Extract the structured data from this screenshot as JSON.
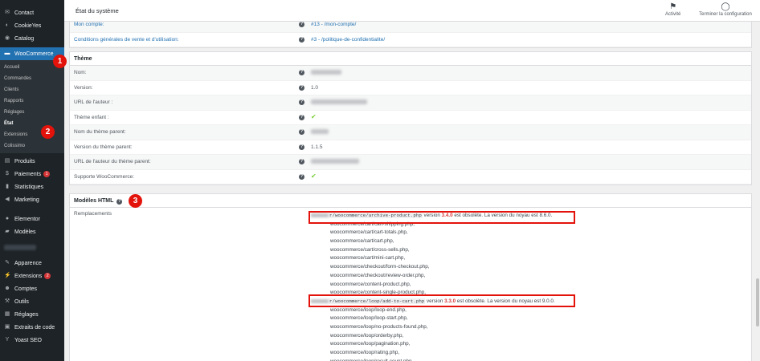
{
  "sidebar": {
    "items_top": [
      {
        "label": "Contact",
        "icon": "mail-icon"
      },
      {
        "label": "CookieYes",
        "icon": "cookie-icon"
      },
      {
        "label": "Catalog",
        "icon": "catalog-icon"
      }
    ],
    "woocommerce": {
      "label": "WooCommerce"
    },
    "woo_submenu": [
      "Accueil",
      "Commandes",
      "Clients",
      "Rapports",
      "Réglages",
      "État",
      "Extensions",
      "Colissimo"
    ],
    "items_mid": [
      {
        "label": "Produits",
        "icon": "products-icon"
      },
      {
        "label": "Paiements",
        "icon": "payments-icon",
        "badge": "1"
      },
      {
        "label": "Statistiques",
        "icon": "stats-icon"
      },
      {
        "label": "Marketing",
        "icon": "megaphone-icon"
      }
    ],
    "items_elementor": [
      {
        "label": "Elementor",
        "icon": "elementor-icon"
      },
      {
        "label": "Modèles",
        "icon": "folder-icon"
      }
    ],
    "items_bottom": [
      {
        "label": "Apparence",
        "icon": "brush-icon"
      },
      {
        "label": "Extensions",
        "icon": "plugin-icon",
        "badge": "2"
      },
      {
        "label": "Comptes",
        "icon": "users-icon"
      },
      {
        "label": "Outils",
        "icon": "wrench-icon"
      },
      {
        "label": "Réglages",
        "icon": "settings-icon"
      },
      {
        "label": "Extraits de code",
        "icon": "code-icon"
      },
      {
        "label": "Yoast SEO",
        "icon": "yoast-icon"
      }
    ]
  },
  "topbar": {
    "title": "État du système",
    "activity_label": "Activité",
    "finish_setup_label": "Terminer la configuration"
  },
  "pages_partial": {
    "rows": [
      {
        "label": "Mon compte:",
        "value": "#13 - /mon-compte/"
      },
      {
        "label": "Conditions générales de vente et d'utilisation:",
        "value": "#3 - /politique-de-confidentialite/"
      }
    ]
  },
  "theme": {
    "header": "Thème",
    "rows": [
      {
        "label": "Nom:",
        "value": ""
      },
      {
        "label": "Version:",
        "value": "1.0"
      },
      {
        "label": "URL de l'auteur :",
        "value": ""
      },
      {
        "label": "Thème enfant :",
        "value": "✔"
      },
      {
        "label": "Nom du thème parent:",
        "value": ""
      },
      {
        "label": "Version du thème parent:",
        "value": "1.1.5"
      },
      {
        "label": "URL de l'auteur du thème parent:",
        "value": ""
      },
      {
        "label": "Supporte WooCommerce:",
        "value": "✔"
      }
    ]
  },
  "templates": {
    "header": "Modèles HTML",
    "row_label": "Remplacements",
    "line1": {
      "file": "r/woocommerce/archive-product.php",
      "pre": " version ",
      "version": "3.4.0",
      "post": " est obsolète. La version du noyau est 8.6.0."
    },
    "list_a": [
      "woocommerce/cart/cart-shipping.php,",
      "woocommerce/cart/cart-totals.php,",
      "woocommerce/cart/cart.php,",
      "woocommerce/cart/cross-sells.php,",
      "woocommerce/cart/mini-cart.php,",
      "woocommerce/checkout/form-checkout.php,",
      "woocommerce/checkout/review-order.php,",
      "woocommerce/content-product.php,",
      "woocommerce/content-single-product.php,"
    ],
    "line2": {
      "file": "r/woocommerce/loop/add-to-cart.php",
      "pre": " version ",
      "version": "3.3.0",
      "post": " est obsolète. La version du noyau est 9.0.0."
    },
    "list_b": [
      "woocommerce/loop/loop-end.php,",
      "woocommerce/loop/loop-start.php,",
      "woocommerce/loop/no-products-found.php,",
      "woocommerce/loop/orderby.php,",
      "woocommerce/loop/pagination.php,",
      "woocommerce/loop/rating.php,",
      "woocommerce/loop/result-count.php,"
    ]
  },
  "callouts": [
    "1",
    "2",
    "3"
  ],
  "colors": {
    "accent": "#2271b1",
    "danger": "#d63638",
    "annotation": "#e3120b",
    "ok": "#7ad03a"
  }
}
